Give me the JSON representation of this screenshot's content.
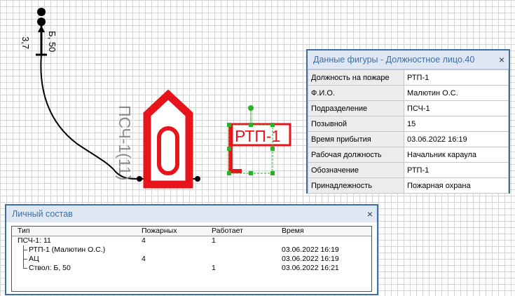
{
  "canvas": {
    "hose_label": "Б, 50",
    "hose_length": "3,7",
    "unit_label": "ПСЧ-1(11)",
    "vehicle_glyph": "0",
    "flag_label": "РТП-1",
    "icons": [
      "truck-icon",
      "flag-icon",
      "nozzle-icon"
    ],
    "colors": {
      "vehicle": "#e8141c",
      "selection": "#27b227",
      "hose": "#000000"
    }
  },
  "shape_panel": {
    "title": "Данные фигуры - Должностное лицо.40",
    "close": "×",
    "rows": [
      {
        "key": "Должность на пожаре",
        "value": "РТП-1"
      },
      {
        "key": "Ф.И.О.",
        "value": "Малютин О.С."
      },
      {
        "key": "Подразделение",
        "value": "ПСЧ-1"
      },
      {
        "key": "Позывной",
        "value": "15"
      },
      {
        "key": "Время прибытия",
        "value": "03.06.2022 16:19"
      },
      {
        "key": "Рабочая должность",
        "value": "Начальник караула"
      },
      {
        "key": "Обозначение",
        "value": "РТП-1"
      },
      {
        "key": "Принадлежность",
        "value": "Пожарная охрана"
      }
    ]
  },
  "personnel": {
    "title": "Личный состав",
    "close": "×",
    "columns": [
      "Тип",
      "Пожарных",
      "Работает",
      "Время"
    ],
    "rows": [
      {
        "type": "ПСЧ-1:  11",
        "firefighters": "4",
        "working": "1",
        "time": ""
      },
      {
        "type": "РТП-1 (Малютин О.С.)",
        "firefighters": "",
        "working": "",
        "time": "03.06.2022 16:19"
      },
      {
        "type": "АЦ",
        "firefighters": "4",
        "working": "",
        "time": "03.06.2022 16:19"
      },
      {
        "type": "Ствол: Б, 50",
        "firefighters": "",
        "working": "1",
        "time": "03.06.2022 16:21"
      }
    ]
  }
}
